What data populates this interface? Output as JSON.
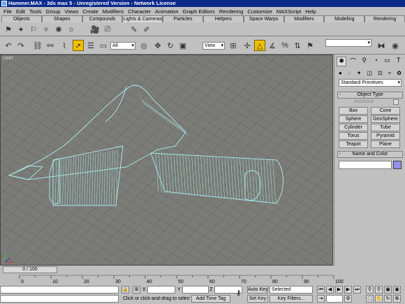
{
  "window": {
    "title": "Hammer.MAX - 3ds max 5 - Unregistered Version - Network License"
  },
  "menu": [
    "File",
    "Edit",
    "Tools",
    "Group",
    "Views",
    "Create",
    "Modifiers",
    "Character",
    "Animation",
    "Graph Editors",
    "Rendering",
    "Customize",
    "MAXScript",
    "Help"
  ],
  "tabs": [
    "Objects",
    "Shapes",
    "Compounds",
    "Lights & Cameras",
    "Particles",
    "Helpers",
    "Space Warps",
    "Modifiers",
    "Modeling",
    "Rendering"
  ],
  "active_tab": "Lights & Cameras",
  "toolbar": {
    "selection_filter": "All",
    "ref_coord": "View",
    "named_selection": ""
  },
  "viewport": {
    "label": "User"
  },
  "command_panel": {
    "category": "Standard Primitives",
    "object_type_title": "Object Type",
    "autogrid_label": "AutoGrid",
    "primitives": [
      "Box",
      "Cone",
      "Sphere",
      "GeoSphere",
      "Cylinder",
      "Tube",
      "Torus",
      "Pyramid",
      "Teapot",
      "Plane"
    ],
    "name_color_title": "Name and Color",
    "swatch_color": "#9090ee"
  },
  "timeline": {
    "slider": "0 / 100",
    "ticks": [
      "0",
      "10",
      "20",
      "30",
      "40",
      "50",
      "60",
      "70",
      "80",
      "90",
      "100"
    ]
  },
  "status": {
    "x_label": "X",
    "y_label": "Y",
    "z_label": "Z",
    "prompt": "Click or click-and-drag to select obj",
    "add_time_tag": "Add Time Tag",
    "auto_key": "Auto Key",
    "key_mode": "Selected",
    "set_key": "Set Key",
    "key_filters": "Key Filters..."
  }
}
